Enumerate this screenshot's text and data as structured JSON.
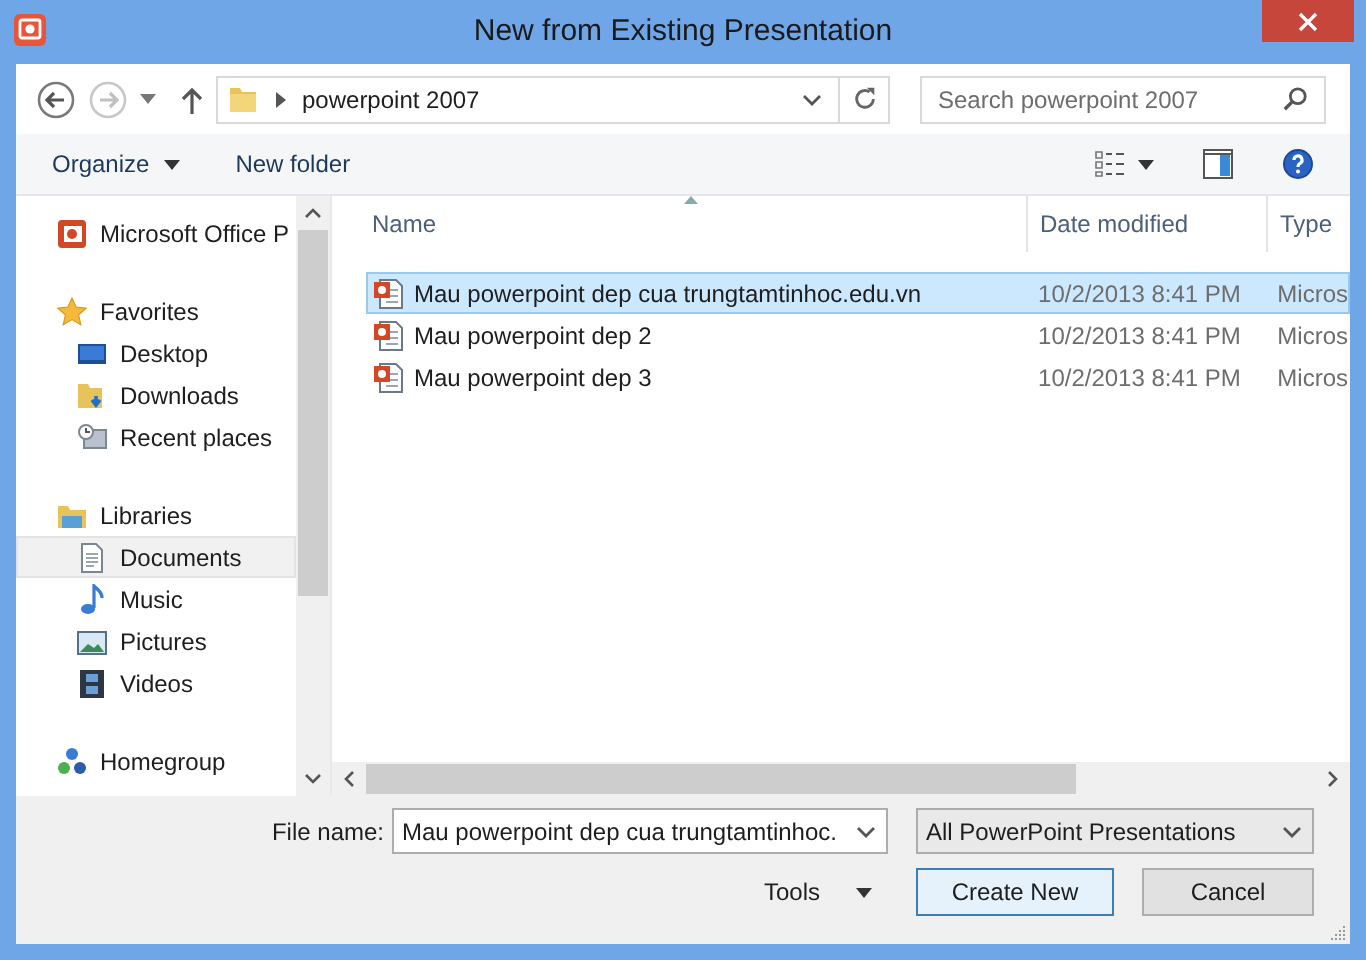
{
  "window": {
    "title": "New from Existing Presentation"
  },
  "address": {
    "path": "powerpoint 2007",
    "search_placeholder": "Search powerpoint 2007"
  },
  "toolbar": {
    "organize": "Organize",
    "new_folder": "New folder"
  },
  "nav": [
    {
      "kind": "app",
      "label": "Microsoft Office P",
      "selected": false
    },
    {
      "kind": "star",
      "label": "Favorites",
      "selected": false,
      "children": [
        {
          "kind": "desktop",
          "label": "Desktop",
          "selected": false
        },
        {
          "kind": "downloads",
          "label": "Downloads",
          "selected": false
        },
        {
          "kind": "recent",
          "label": "Recent places",
          "selected": false
        }
      ]
    },
    {
      "kind": "libraries",
      "label": "Libraries",
      "selected": false,
      "children": [
        {
          "kind": "documents",
          "label": "Documents",
          "selected": true
        },
        {
          "kind": "music",
          "label": "Music",
          "selected": false
        },
        {
          "kind": "pictures",
          "label": "Pictures",
          "selected": false
        },
        {
          "kind": "videos",
          "label": "Videos",
          "selected": false
        }
      ]
    },
    {
      "kind": "homegroup",
      "label": "Homegroup",
      "selected": false
    }
  ],
  "columns": [
    "Name",
    "Date modified",
    "Type"
  ],
  "files": [
    {
      "name": "Mau powerpoint dep cua trungtamtinhoc.edu.vn",
      "date": "10/2/2013 8:41 PM",
      "type": "Micros",
      "selected": true
    },
    {
      "name": "Mau powerpoint dep 2",
      "date": "10/2/2013 8:41 PM",
      "type": "Micros",
      "selected": false
    },
    {
      "name": "Mau powerpoint dep 3",
      "date": "10/2/2013 8:41 PM",
      "type": "Micros",
      "selected": false
    }
  ],
  "footer": {
    "file_name_label": "File name:",
    "file_name": "Mau powerpoint dep cua trungtamtinhoc.",
    "file_type": "All PowerPoint Presentations",
    "tools": "Tools",
    "buttons": [
      {
        "label": "Create New",
        "default": true
      },
      {
        "label": "Cancel",
        "default": false
      }
    ]
  }
}
